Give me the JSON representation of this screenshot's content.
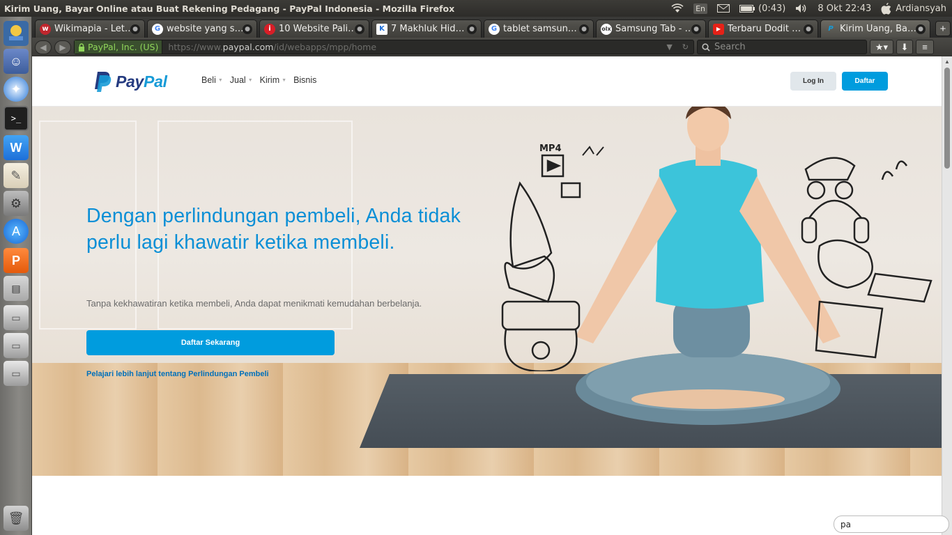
{
  "window": {
    "title": "Kirim Uang, Bayar Online atau Buat Rekening Pedagang - PayPal Indonesia - Mozilla Firefox"
  },
  "indicators": {
    "language": "En",
    "battery": "(0:43)",
    "datetime": "8 Okt 22:43",
    "user": "Ardiansyah"
  },
  "tabs": [
    {
      "label": "Wikimapia - Let…",
      "favicon_color": "#c0262d",
      "icon": "wikimapia-icon"
    },
    {
      "label": "website yang s…",
      "favicon_color": "#4285f4",
      "icon": "google-icon"
    },
    {
      "label": "10 Website Pali…",
      "favicon_color": "#d81e27",
      "icon": "info-icon"
    },
    {
      "label": "7 Makhluk Hid…",
      "favicon_color": "#1d6fd8",
      "icon": "kompas-icon"
    },
    {
      "label": "tablet samsun…",
      "favicon_color": "#4285f4",
      "icon": "google-icon"
    },
    {
      "label": "Samsung Tab - …",
      "favicon_color": "#f5a623",
      "icon": "olx-icon"
    },
    {
      "label": "Terbaru Dodit …",
      "favicon_color": "#e62117",
      "icon": "youtube-icon"
    },
    {
      "label": "Kirim Uang, Ba…",
      "favicon_color": "#179bd7",
      "icon": "paypal-icon",
      "active": true
    }
  ],
  "navbar": {
    "identity": "PayPal, Inc. (US)",
    "url_prefix": "https://www.",
    "url_domain": "paypal.com",
    "url_path": "/id/webapps/mpp/home",
    "search_placeholder": "Search"
  },
  "paypal": {
    "logo_left": "Pay",
    "logo_right": "Pal",
    "nav": [
      {
        "label": "Beli",
        "has_caret": true
      },
      {
        "label": "Jual",
        "has_caret": true
      },
      {
        "label": "Kirim",
        "has_caret": true
      },
      {
        "label": "Bisnis",
        "has_caret": false
      }
    ],
    "login_label": "Log In",
    "signup_label": "Daftar",
    "hero_title": "Dengan perlindungan pembeli, Anda tidak perlu lagi khawatir ketika membeli.",
    "hero_subtitle": "Tanpa kekhawatiran ketika membeli, Anda dapat menikmati kemudahan berbelanja.",
    "hero_cta": "Daftar Sekarang",
    "hero_link": "Pelajari lebih lanjut tentang Perlindungan Pembeli",
    "accent_color": "#009cde",
    "brand_dark": "#253b80"
  },
  "findbar": {
    "value": "pa"
  }
}
